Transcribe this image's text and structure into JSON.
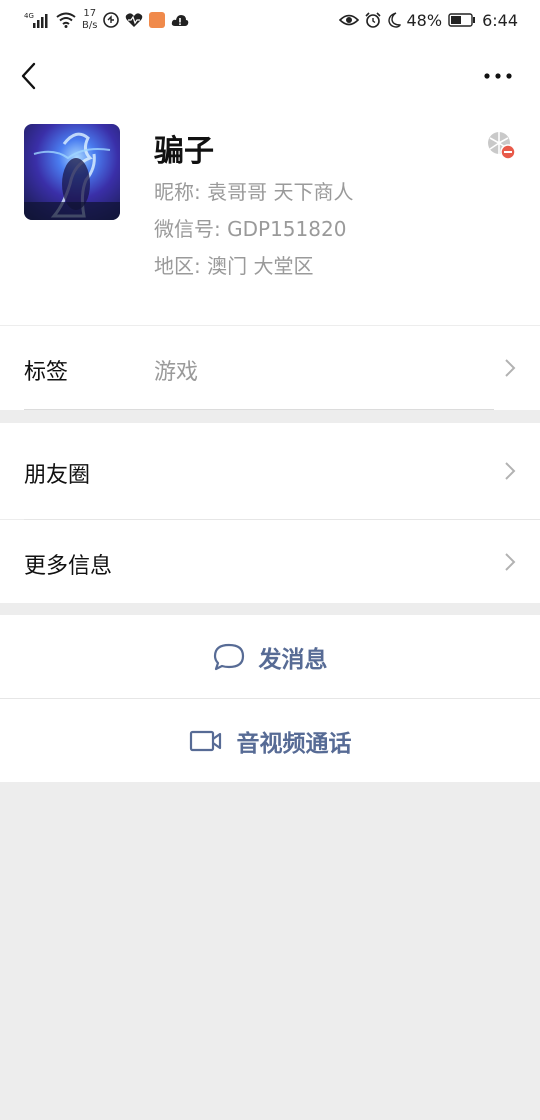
{
  "status_bar": {
    "signal": "4G",
    "net_speed_value": "17",
    "net_speed_unit": "B/s",
    "battery": "48%",
    "time": "6:44"
  },
  "profile": {
    "display_name": "骗子",
    "nickname_label": "昵称:",
    "nickname": "袁哥哥 天下商人",
    "wechat_id_label": "微信号:",
    "wechat_id": "GDP151820",
    "region_label": "地区:",
    "region": "澳门 大堂区"
  },
  "rows": {
    "tags_label": "标签",
    "tags_value": "游戏",
    "moments_label": "朋友圈",
    "more_info_label": "更多信息"
  },
  "actions": {
    "message_label": "发消息",
    "call_label": "音视频通话"
  },
  "colors": {
    "accent": "#576b95",
    "background": "#ededed"
  }
}
